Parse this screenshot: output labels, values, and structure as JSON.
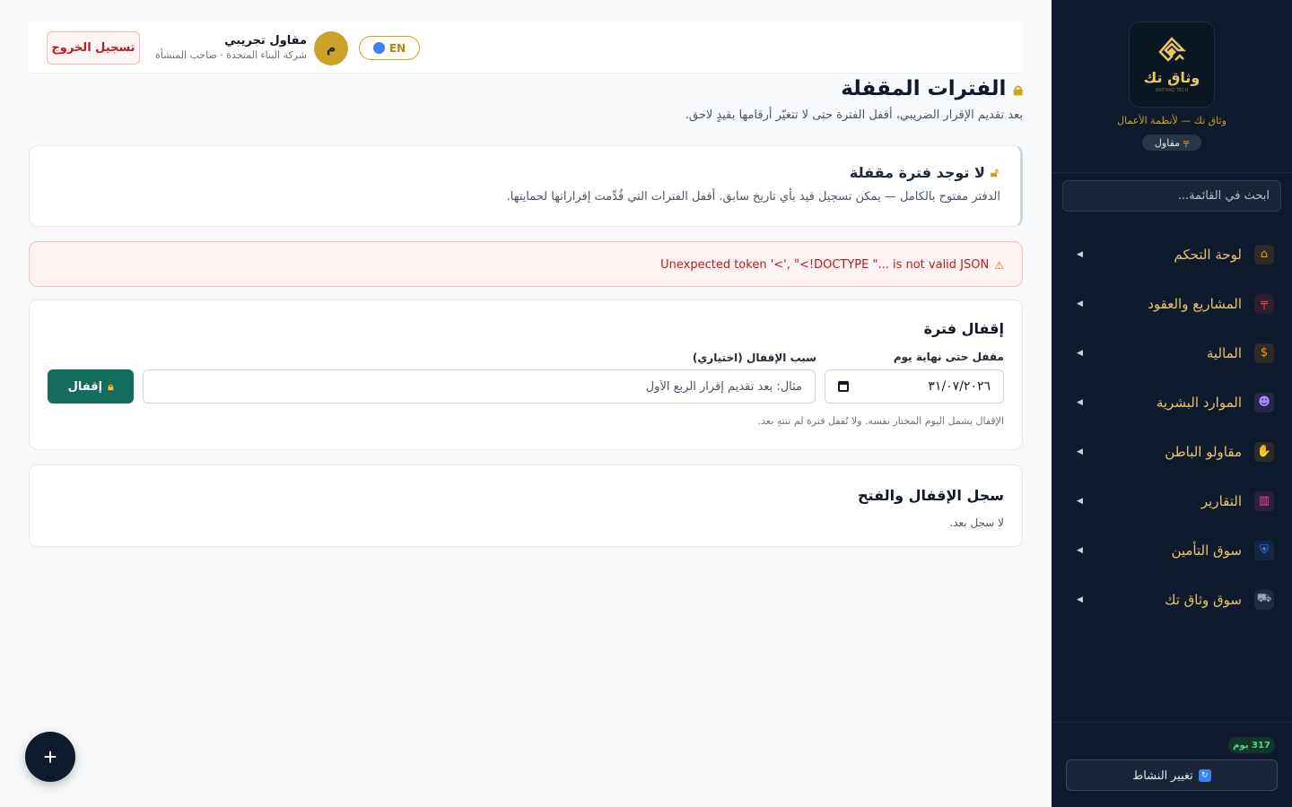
{
  "sidebar": {
    "logo": {
      "name": "وثاق تك",
      "sub": "WATHAQ TECH"
    },
    "tagline": "وثاق تك — لأنظمة الأعمال",
    "role": "مقاول",
    "search_placeholder": "ابحث في القائمة...",
    "items": [
      {
        "label": "لوحة التحكم",
        "icon": "house-icon",
        "color": "#f59e0b",
        "glyph": "⌂"
      },
      {
        "label": "المشاريع والعقود",
        "icon": "crane-icon",
        "color": "#ef4444",
        "glyph": "╤"
      },
      {
        "label": "المالية",
        "icon": "money-bag-icon",
        "color": "#f59e0b",
        "glyph": "$"
      },
      {
        "label": "الموارد البشرية",
        "icon": "worker-icon",
        "color": "#a78bfa",
        "glyph": "☻"
      },
      {
        "label": "مقاولو الباطن",
        "icon": "handshake-icon",
        "color": "#f59e0b",
        "glyph": "✋"
      },
      {
        "label": "التقارير",
        "icon": "bar-chart-icon",
        "color": "#ec4899",
        "glyph": "▥"
      },
      {
        "label": "سوق التأمين",
        "icon": "shield-icon",
        "color": "#3b82f6",
        "glyph": "⛨"
      },
      {
        "label": "سوق وثاق تك",
        "icon": "cart-icon",
        "color": "#64748b",
        "glyph": "⛟"
      }
    ],
    "days_left": "317 يوم",
    "switch_label": "تغيير النشاط"
  },
  "topbar": {
    "logout": "تسجيل الخروج",
    "user_name": "مقاول تجريبي",
    "user_org": "شركة البناء المتحدة · صاحب المنشأة",
    "avatar_initial": "م",
    "lang": "EN"
  },
  "page": {
    "title": "الفترات المقفلة",
    "subtitle": "بعد تقديم الإقرار الضريبي، أقفل الفترة حتى لا تتغيّر أرقامها بقيدٍ لاحق."
  },
  "status": {
    "title": "لا توجد فترة مقفلة",
    "desc": "الدفتر مفتوح بالكامل — يمكن تسجيل قيد بأي تاريخ سابق. أقفل الفترات التي قُدِّمت إقراراتها لحمايتها."
  },
  "error": {
    "message": "Unexpected token '<', \"<!DOCTYPE \"... is not valid JSON"
  },
  "lock_form": {
    "title": "إقفال فترة",
    "date_label": "مقفل حتى نهاية يوم",
    "date_value": "٣١/٠٧/٢٠٢٦",
    "reason_label": "سبب الإقفال (اختياري)",
    "reason_placeholder": "مثال: بعد تقديم إقرار الربع الأول",
    "button": "إقفال",
    "note": "الإقفال يشمل اليوم المختار نفسه. ولا تُقفل فترة لم تنتهِ بعد."
  },
  "log": {
    "title": "سجل الإقفال والفتح",
    "empty": "لا سجل بعد."
  },
  "fab": {
    "label": "+"
  }
}
